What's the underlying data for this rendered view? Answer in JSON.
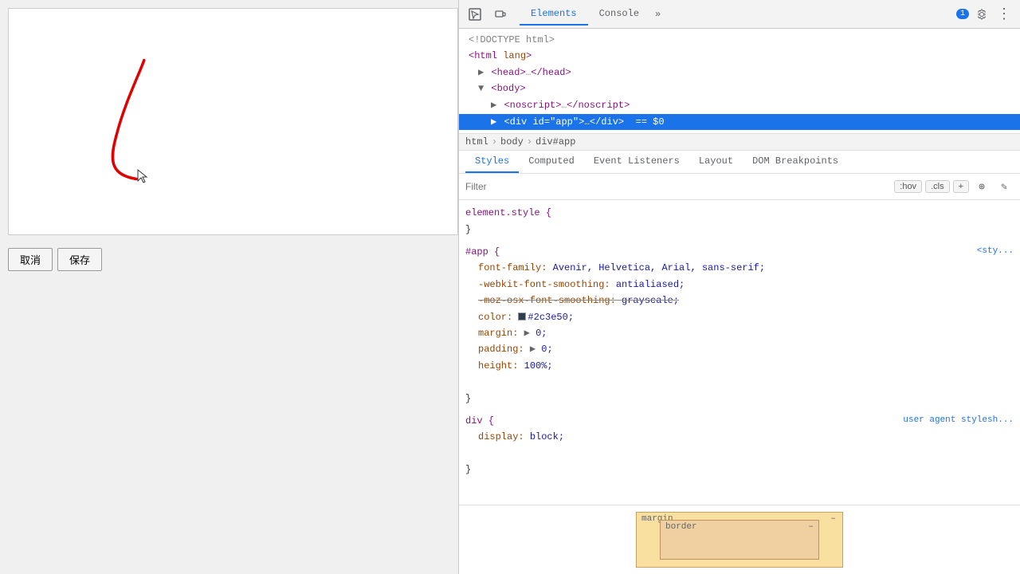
{
  "left": {
    "cancel_btn": "取消",
    "save_btn": "保存"
  },
  "devtools": {
    "toolbar": {
      "inspect_icon": "⬚",
      "device_icon": "▭",
      "tabs": [
        "Elements",
        "Console"
      ],
      "active_tab": "Elements",
      "more_icon": "»",
      "notification_count": "1",
      "settings_icon": "⚙",
      "more_vert_icon": "⋮"
    },
    "dom": {
      "lines": [
        {
          "indent": 0,
          "content": "<!DOCTYPE html>",
          "type": "comment"
        },
        {
          "indent": 0,
          "content": "<html lang>",
          "type": "tag"
        },
        {
          "indent": 1,
          "content": "▶ <head>…</head>",
          "type": "tag"
        },
        {
          "indent": 1,
          "content": "▼ <body>",
          "type": "tag"
        },
        {
          "indent": 2,
          "content": "▶ <noscript>…</noscript>",
          "type": "tag"
        },
        {
          "indent": 2,
          "content": "▶  <div id=\"app\">…</div>  == $0",
          "type": "selected"
        }
      ]
    },
    "breadcrumb": [
      "html",
      "body",
      "div#app"
    ],
    "style_tabs": [
      "Styles",
      "Computed",
      "Event Listeners",
      "Layout",
      "DOM Breakpoints"
    ],
    "active_style_tab": "Styles",
    "filter_placeholder": "Filter",
    "filter_btns": [
      ":hov",
      ".cls",
      "+"
    ],
    "css_rules": {
      "element_style": {
        "selector": "element.style {",
        "properties": []
      },
      "app_rule": {
        "selector": "#app {",
        "source": "<sty...",
        "properties": [
          {
            "name": "font-family:",
            "value": "Avenir, Helvetica, Arial, sans-serif;",
            "strikethrough": false
          },
          {
            "name": "-webkit-font-smoothing:",
            "value": "antialiased;",
            "strikethrough": false
          },
          {
            "name": "-moz-osx-font-smoothing:",
            "value": "grayscale;",
            "strikethrough": true
          },
          {
            "name": "color:",
            "value": "#2c3e50;",
            "swatch": "#2c3e50",
            "strikethrough": false
          },
          {
            "name": "margin:",
            "value": "0;",
            "has_arrow": true,
            "strikethrough": false
          },
          {
            "name": "padding:",
            "value": "0;",
            "has_arrow": true,
            "strikethrough": false
          },
          {
            "name": "height:",
            "value": "100%;",
            "strikethrough": false
          }
        ]
      },
      "div_rule": {
        "selector": "div {",
        "source": "user agent stylesh...",
        "properties": [
          {
            "name": "display:",
            "value": "block;",
            "strikethrough": false
          }
        ]
      }
    },
    "box_model": {
      "margin_label": "margin",
      "margin_dash": "–",
      "border_label": "border",
      "border_dash": "–"
    }
  }
}
